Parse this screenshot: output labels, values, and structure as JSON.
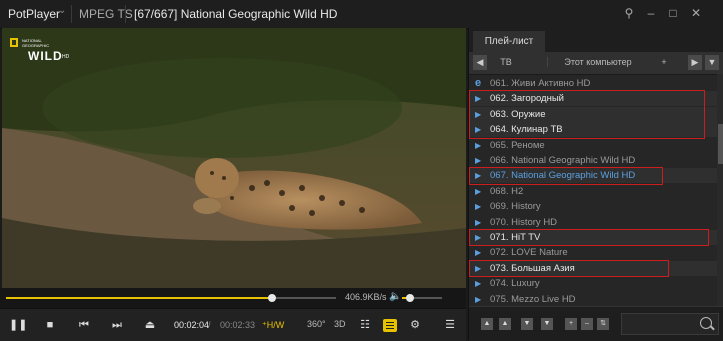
{
  "titlebar": {
    "app_name": "PotPlayer",
    "format": "MPEG TS",
    "title": "[67/667] National Geographic Wild HD",
    "icons": [
      "chevron-down-icon",
      "pin-icon",
      "minimize-icon",
      "maximize-icon",
      "close-icon"
    ]
  },
  "video": {
    "channel_logo_text": "WILD",
    "channel_logo_small": "NATIONAL GEOGRAPHIC",
    "logo_suffix": "HD"
  },
  "seekbar": {
    "progress": 0.805,
    "speed": "406.9KB/s",
    "volume": 0.2
  },
  "controls": {
    "time_current": "00:02:04",
    "time_sep": "/",
    "time_total": "00:02:33",
    "hw": "H/W",
    "btn_360": "360°",
    "btn_3d": "3D"
  },
  "playlist": {
    "tab": "Плей-лист",
    "subtabs": [
      "ТВ",
      "Этот компьютер",
      "+"
    ],
    "items": [
      {
        "label": "061. Живи Активно HD",
        "icon": "ie-icon",
        "style": "dim"
      },
      {
        "label": "062. Загородный",
        "icon": "play-icon",
        "style": "bright"
      },
      {
        "label": "063. Оружие",
        "icon": "play-icon",
        "style": "bright"
      },
      {
        "label": "064. Кулинар ТВ",
        "icon": "play-icon",
        "style": "bright"
      },
      {
        "label": "065. Реноме",
        "icon": "play-icon",
        "style": "dim"
      },
      {
        "label": "066. National Geographic Wild HD",
        "icon": "play-icon",
        "style": "dim"
      },
      {
        "label": "067. National Geographic Wild HD",
        "icon": "play-icon",
        "style": "current"
      },
      {
        "label": "068. H2",
        "icon": "play-icon",
        "style": "dim"
      },
      {
        "label": "069. History",
        "icon": "play-icon",
        "style": "dim"
      },
      {
        "label": "070. History HD",
        "icon": "play-icon",
        "style": "dim"
      },
      {
        "label": "071. HiT TV",
        "icon": "play-icon",
        "style": "bright"
      },
      {
        "label": "072. LOVE Nature",
        "icon": "play-icon",
        "style": "dim"
      },
      {
        "label": "073. Большая Азия",
        "icon": "play-icon",
        "style": "bright"
      },
      {
        "label": "074. Luxury",
        "icon": "play-icon",
        "style": "dim"
      },
      {
        "label": "075. Mezzo Live HD",
        "icon": "play-icon",
        "style": "dim"
      }
    ]
  },
  "colors": {
    "accent": "#e6c200",
    "current": "#5aa0e0",
    "highlight_box": "#cc1e1e"
  }
}
